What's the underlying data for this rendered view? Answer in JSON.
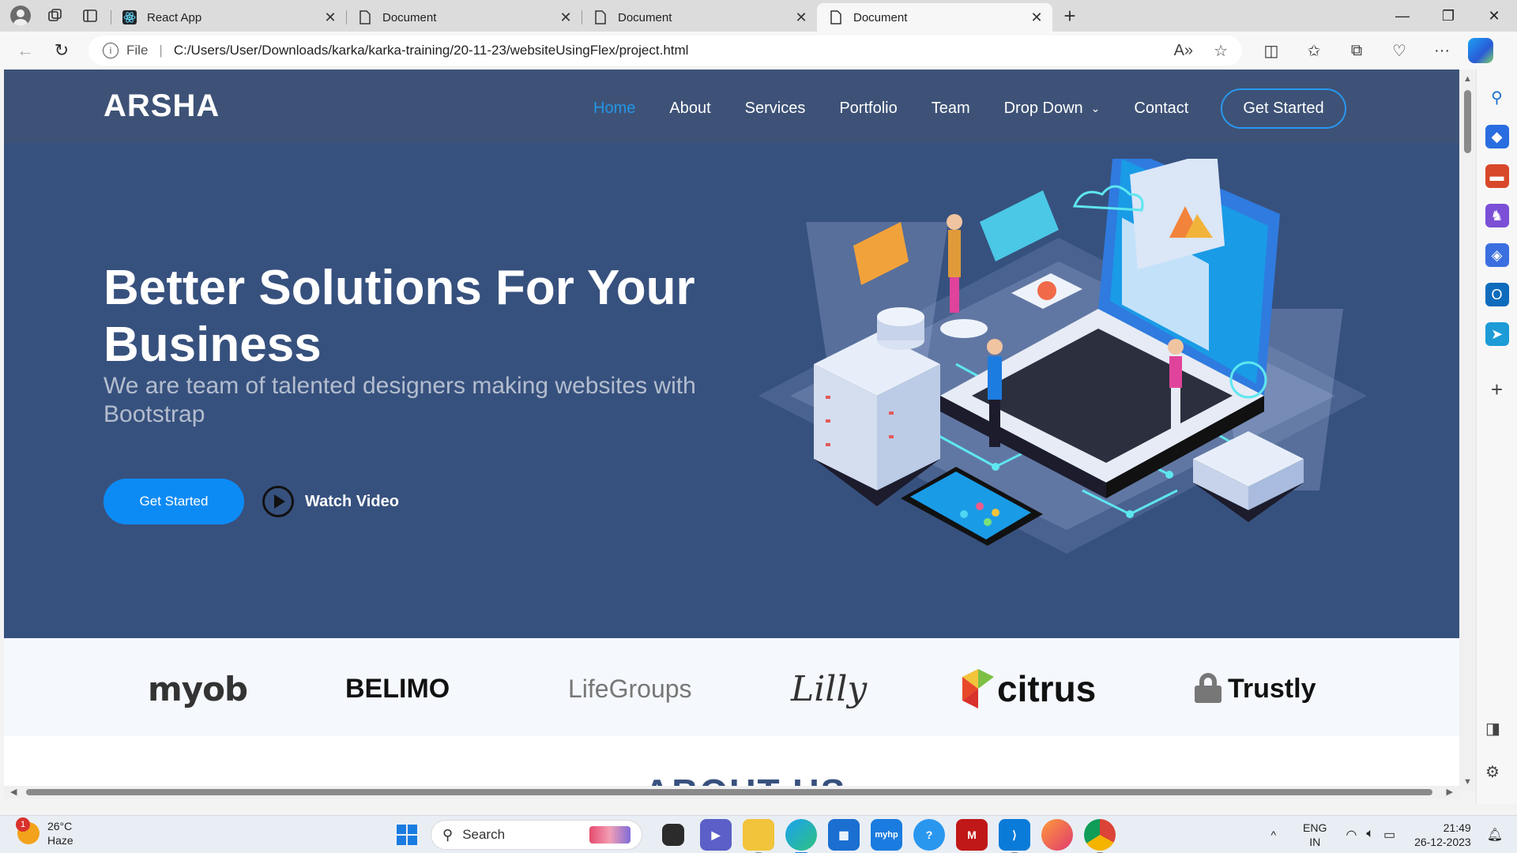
{
  "browser": {
    "tabs": [
      {
        "title": "React App",
        "icon": "react-icon",
        "active": false
      },
      {
        "title": "Document",
        "icon": "page-icon",
        "active": false
      },
      {
        "title": "Document",
        "icon": "page-icon",
        "active": false
      },
      {
        "title": "Document",
        "icon": "page-icon",
        "active": true
      }
    ],
    "address": {
      "scheme_label": "File",
      "url": "C:/Users/User/Downloads/karka/karka-training/20-11-23/websiteUsingFlex/project.html"
    }
  },
  "site": {
    "logo": "ARSHA",
    "nav": [
      {
        "label": "Home",
        "active": true
      },
      {
        "label": "About"
      },
      {
        "label": "Services"
      },
      {
        "label": "Portfolio"
      },
      {
        "label": "Team"
      },
      {
        "label": "Drop Down",
        "has_dropdown": true
      },
      {
        "label": "Contact"
      }
    ],
    "nav_cta": "Get Started",
    "hero": {
      "title": "Better Solutions For Your Business",
      "subtitle": "We are team of talented designers making websites with Bootstrap",
      "primary_button": "Get Started",
      "video_button": "Watch Video"
    },
    "clients": [
      "myob",
      "BELIMO",
      "LifeGroups",
      "Lilly",
      "citrus",
      "Trustly"
    ],
    "next_section_title": "ABOUT US"
  },
  "taskbar": {
    "weather": {
      "temp": "26°C",
      "condition": "Haze",
      "badge": "1"
    },
    "search_placeholder": "Search",
    "language": {
      "top": "ENG",
      "bottom": "IN"
    },
    "time": "21:49",
    "date": "26-12-2023"
  },
  "colors": {
    "header_bg": "#3d5276",
    "hero_bg": "#37517e",
    "accent": "#0d8bf5",
    "clients_bg": "#f5f8fd"
  }
}
